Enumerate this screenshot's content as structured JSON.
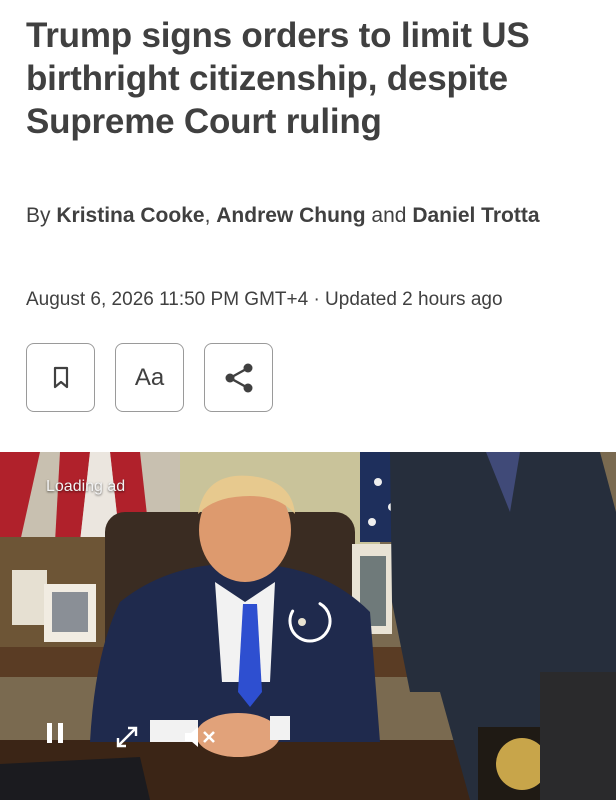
{
  "article": {
    "headline": "Trump signs orders to limit US birthright citizenship, despite Supreme Court ruling",
    "byline": {
      "prefix": "By",
      "author1": "Kristina Cooke",
      "sep1": ",",
      "author2": "Andrew Chung",
      "and": "and",
      "author3": "Daniel Trotta"
    },
    "dateline": "August 6, 2026 11:50 PM GMT+4 · Updated 2 hours ago"
  },
  "actions": {
    "bookmark_icon": "bookmark-icon",
    "text_size_label": "Aa",
    "share_icon": "share-icon"
  },
  "video": {
    "loading_text": "Loading ad",
    "controls": [
      "pause-icon",
      "expand-icon",
      "mute-icon"
    ]
  },
  "colors": {
    "text": "#404040",
    "border": "#9a9a9a",
    "suit": "#1f2a4d",
    "tie": "#2e4fd0"
  }
}
